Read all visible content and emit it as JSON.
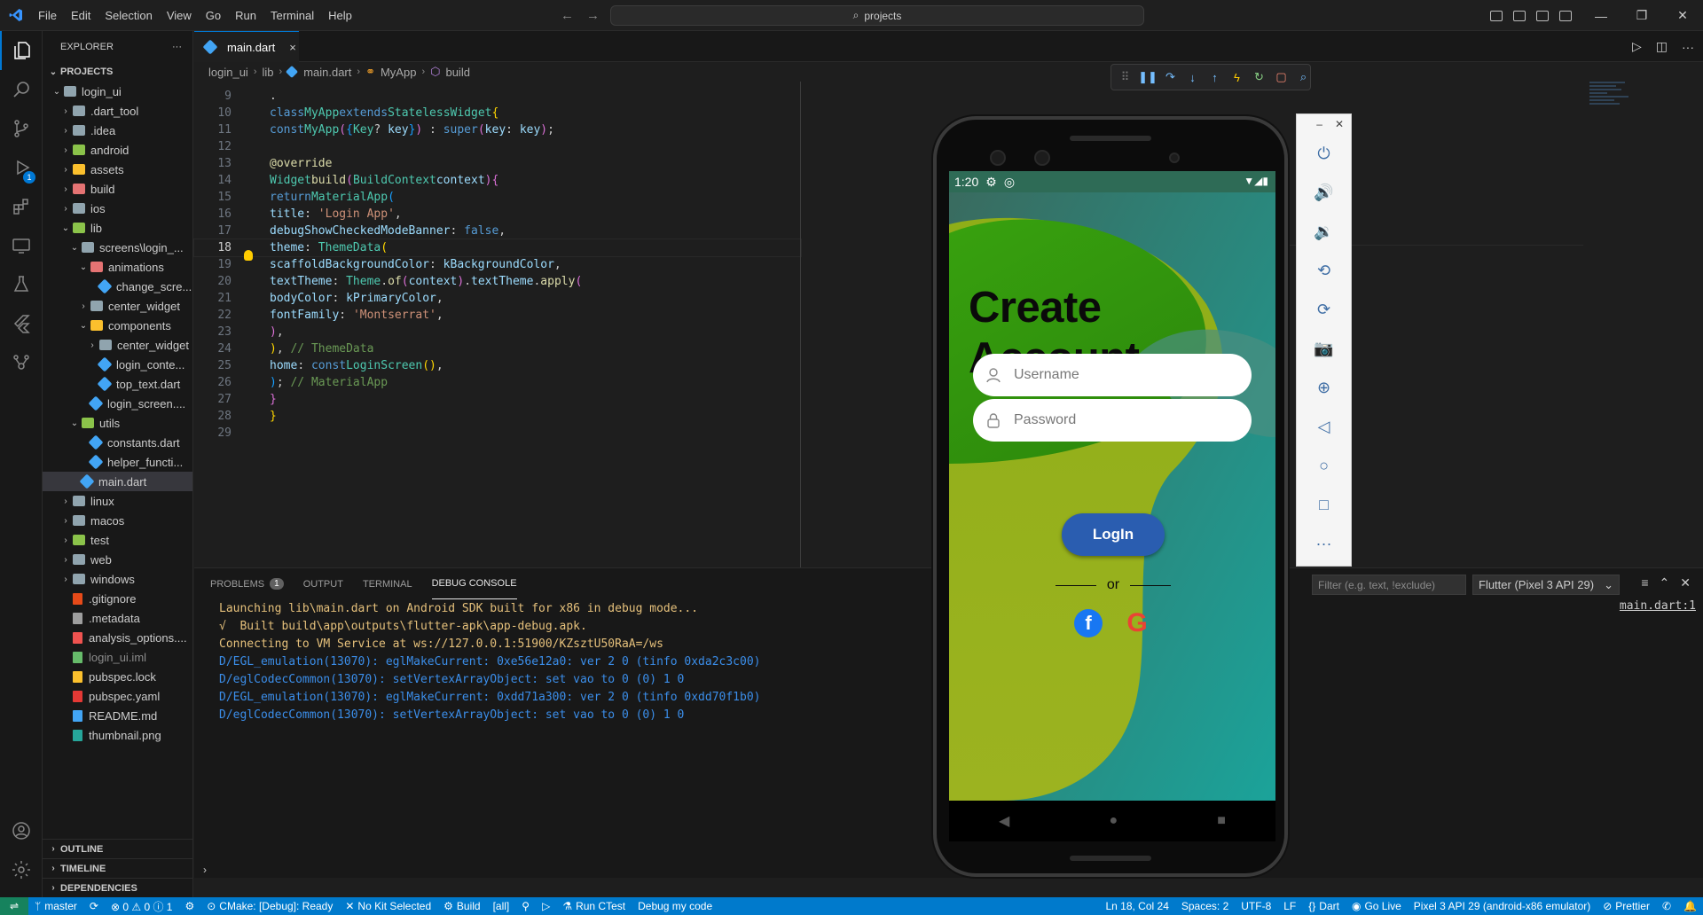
{
  "menu": [
    "File",
    "Edit",
    "Selection",
    "View",
    "Go",
    "Run",
    "Terminal",
    "Help"
  ],
  "command_center": "projects",
  "activity_badge": "1",
  "sidebar": {
    "title": "EXPLORER",
    "more": "···",
    "section": "PROJECTS",
    "tree": [
      {
        "label": "login_ui",
        "type": "folder",
        "open": true,
        "depth": 1
      },
      {
        "label": ".dart_tool",
        "type": "folder",
        "depth": 2
      },
      {
        "label": ".idea",
        "type": "folder-gray",
        "depth": 2
      },
      {
        "label": "android",
        "type": "folder-green",
        "depth": 2
      },
      {
        "label": "assets",
        "type": "folder-yellow",
        "depth": 2
      },
      {
        "label": "build",
        "type": "folder-red",
        "depth": 2
      },
      {
        "label": "ios",
        "type": "folder",
        "depth": 2
      },
      {
        "label": "lib",
        "type": "folder-lib",
        "open": true,
        "depth": 2
      },
      {
        "label": "screens\\login_...",
        "type": "folder",
        "open": true,
        "depth": 3
      },
      {
        "label": "animations",
        "type": "folder-red",
        "open": true,
        "depth": 4
      },
      {
        "label": "change_scre...",
        "type": "dart",
        "depth": 5
      },
      {
        "label": "center_widget",
        "type": "folder",
        "depth": 4
      },
      {
        "label": "components",
        "type": "folder-yellow",
        "open": true,
        "depth": 4
      },
      {
        "label": "center_widget",
        "type": "folder",
        "depth": 5
      },
      {
        "label": "login_conte...",
        "type": "dart",
        "depth": 5
      },
      {
        "label": "top_text.dart",
        "type": "dart",
        "depth": 5
      },
      {
        "label": "login_screen....",
        "type": "dart",
        "depth": 4
      },
      {
        "label": "utils",
        "type": "folder-green",
        "open": true,
        "depth": 3
      },
      {
        "label": "constants.dart",
        "type": "dart",
        "depth": 4
      },
      {
        "label": "helper_functi...",
        "type": "dart",
        "depth": 4
      },
      {
        "label": "main.dart",
        "type": "dart",
        "depth": 3,
        "selected": true
      },
      {
        "label": "linux",
        "type": "folder",
        "depth": 2
      },
      {
        "label": "macos",
        "type": "folder",
        "depth": 2
      },
      {
        "label": "test",
        "type": "folder-green",
        "depth": 2
      },
      {
        "label": "web",
        "type": "folder",
        "depth": 2
      },
      {
        "label": "windows",
        "type": "folder",
        "depth": 2
      },
      {
        "label": ".gitignore",
        "type": "git",
        "depth": 2
      },
      {
        "label": ".metadata",
        "type": "plain",
        "depth": 2
      },
      {
        "label": "analysis_options....",
        "type": "yaml",
        "depth": 2
      },
      {
        "label": "login_ui.iml",
        "type": "iml",
        "depth": 2,
        "dim": true
      },
      {
        "label": "pubspec.lock",
        "type": "lock",
        "depth": 2
      },
      {
        "label": "pubspec.yaml",
        "type": "yaml-red",
        "depth": 2
      },
      {
        "label": "README.md",
        "type": "info",
        "depth": 2
      },
      {
        "label": "thumbnail.png",
        "type": "image",
        "depth": 2
      }
    ],
    "bottom_sections": [
      "OUTLINE",
      "TIMELINE",
      "DEPENDENCIES"
    ]
  },
  "tab": {
    "label": "main.dart",
    "close": "×"
  },
  "breadcrumb": [
    "login_ui",
    "lib",
    "main.dart",
    "MyApp",
    "build"
  ],
  "editor": {
    "current_line": 18,
    "line_numbers": [
      "9",
      "10",
      "11",
      "12",
      "13",
      "14",
      "15",
      "16",
      "17",
      "18",
      "19",
      "20",
      "21",
      "22",
      "23",
      "24",
      "25",
      "26",
      "27",
      "28",
      "29"
    ]
  },
  "panel": {
    "tabs": [
      {
        "label": "PROBLEMS",
        "count": "1"
      },
      {
        "label": "OUTPUT"
      },
      {
        "label": "TERMINAL"
      },
      {
        "label": "DEBUG CONSOLE",
        "active": true
      }
    ],
    "console_lines": [
      {
        "text": "Launching lib\\main.dart on Android SDK built for x86 in debug mode...",
        "color": "orange"
      },
      {
        "text": "√  Built build\\app\\outputs\\flutter-apk\\app-debug.apk.",
        "color": "orange"
      },
      {
        "text": "Connecting to VM Service at ws://127.0.0.1:51900/KZsztU50RaA=/ws",
        "color": "orange"
      },
      {
        "text": "D/EGL_emulation(13070): eglMakeCurrent: 0xe56e12a0: ver 2 0 (tinfo 0xda2c3c00)",
        "color": "blue"
      },
      {
        "text": "D/eglCodecCommon(13070): setVertexArrayObject: set vao to 0 (0) 1 0",
        "color": "blue"
      },
      {
        "text": "D/EGL_emulation(13070): eglMakeCurrent: 0xdd71a300: ver 2 0 (tinfo 0xdd70f1b0)",
        "color": "blue"
      },
      {
        "text": "D/eglCodecCommon(13070): setVertexArrayObject: set vao to 0 (0) 1 0",
        "color": "blue"
      }
    ],
    "filter_placeholder": "Filter (e.g. text, !exclude)",
    "device": "Flutter (Pixel 3 API 29)",
    "source_link": "main.dart:1"
  },
  "status": {
    "branch": "master",
    "problems": "⊗ 0 ⚠ 0 ⓘ 1",
    "cmake": "CMake: [Debug]: Ready",
    "kit": "No Kit Selected",
    "build": "Build",
    "target": "[all]",
    "ctest": "Run CTest",
    "debug": "Debug my code",
    "position": "Ln 18, Col 24",
    "spaces": "Spaces: 2",
    "encoding": "UTF-8",
    "eol": "LF",
    "language": "Dart",
    "golive": "Go Live",
    "device": "Pixel 3 API 29 (android-x86 emulator)",
    "prettier": "Prettier"
  },
  "phone": {
    "time": "1:20",
    "title_line1": "Create",
    "title_line2": "Account",
    "username_placeholder": "Username",
    "password_placeholder": "Password",
    "login_label": "LogIn",
    "or_label": "or",
    "colors": {
      "accent": "#2a5db0",
      "green": "#3f9a12",
      "teal": "#1b7a78",
      "yellow_green": "#9ab71c"
    }
  }
}
